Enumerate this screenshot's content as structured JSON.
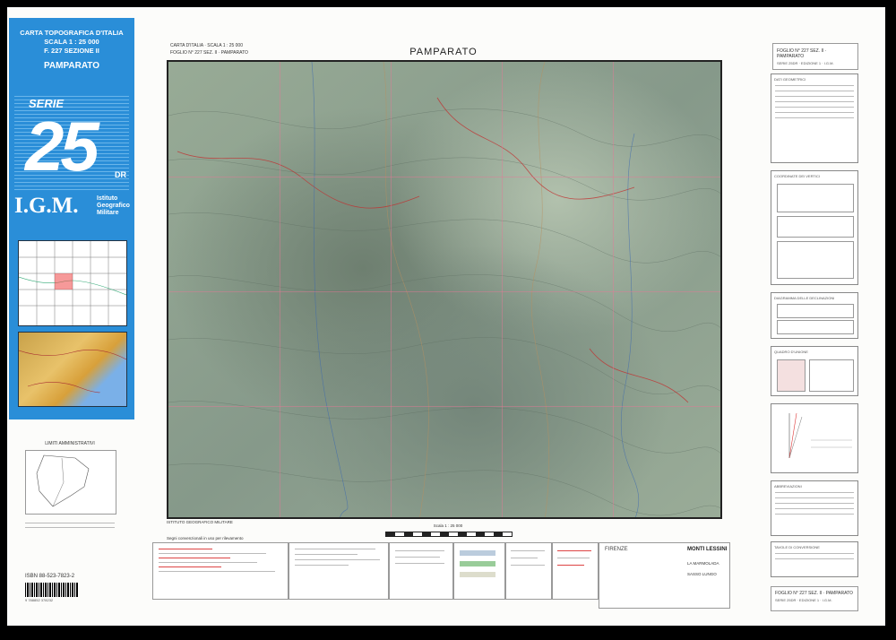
{
  "cover": {
    "line1": "CARTA TOPOGRAFICA D'ITALIA",
    "line2": "SCALA 1 : 25 000",
    "line3": "F. 227 SEZIONE II",
    "name": "PAMPARATO",
    "serie": "SERIE",
    "number": "25",
    "dr": "DR",
    "igm": "I.G.M.",
    "institute": "Istituto Geografico Militare",
    "limits_title": "LIMITI AMMINISTRATIVI",
    "isbn": "ISBN 88-523-7823-2",
    "barcode_num": "9 788852 378232"
  },
  "header": {
    "left_line1": "CARTA D'ITALIA · SCALA 1 : 25 000",
    "left_line2": "FOGLIO N° 227 SEZ. II · PAMPARATO",
    "title": "PAMPARATO",
    "right_line1": "FOGLIO N° 227 SEZ. II · PAMPARATO",
    "right_line2": "SERIE 25DR · EDIZIONE 1 · I.G.M."
  },
  "below_map": {
    "institute": "ISTITUTO GEOGRAFICO MILITARE",
    "signs": "Segni convenzionali in uso per rilevamento",
    "scale": "Scala 1 : 25 000",
    "compass_note": "N"
  },
  "side_panels": {
    "p1": "DATI GEOMETRICI",
    "p2": "COORDINATE DEI VERTICI",
    "p3": "DIAGRAMMA DELLE DECLINAZIONI",
    "p4": "QUADRO D'UNIONE",
    "p5": "ABBREVIAZIONI",
    "p6": "TAVOLE DI CONVERSIONE"
  },
  "legend_bottom": {
    "firenze": "FIRENZE",
    "monti": "MONTI LESSINI",
    "marmolada": "LA MARMOLADA",
    "sasso": "SASSO LUNGO",
    "footer_line1": "FOGLIO N° 227 SEZ. II · PAMPARATO",
    "footer_line2": "SERIE 25DR · EDIZIONE 1 · I.G.M."
  }
}
